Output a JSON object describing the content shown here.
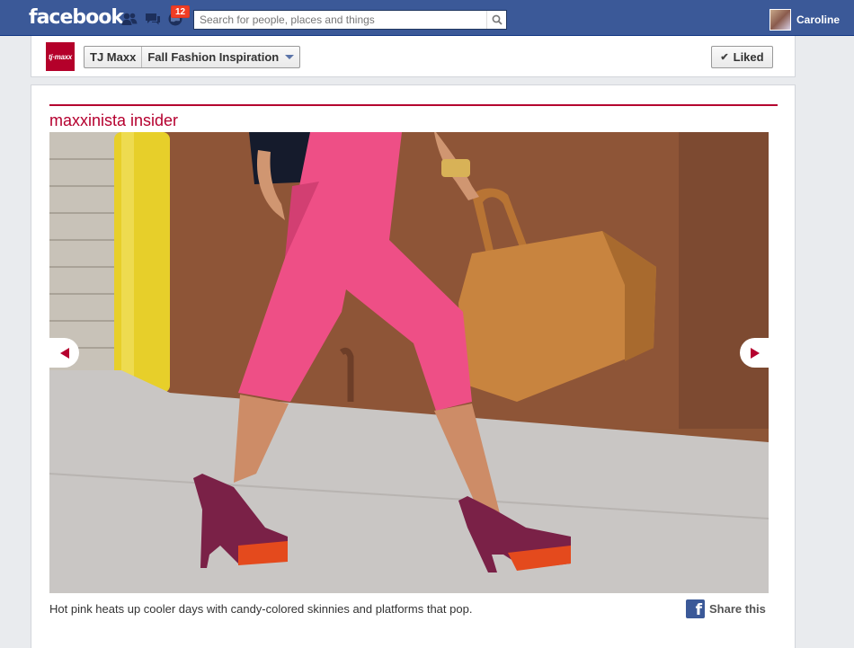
{
  "topbar": {
    "logo": "facebook",
    "notification_count": "12",
    "search_placeholder": "Search for people, places and things",
    "user_name": "Caroline",
    "icons": [
      "friend-requests-icon",
      "messages-icon",
      "notifications-icon",
      "search-icon"
    ]
  },
  "page_header": {
    "logo_text": "tj·maxx",
    "page_name": "TJ Maxx",
    "tab_name": "Fall Fashion Inspiration",
    "liked_label": "Liked"
  },
  "content": {
    "section_title": "maxxinista insider",
    "caption": "Hot pink heats up cooler days with candy-colored skinnies and platforms that pop.",
    "share_label": "Share this",
    "accent_color": "#b5002f"
  }
}
